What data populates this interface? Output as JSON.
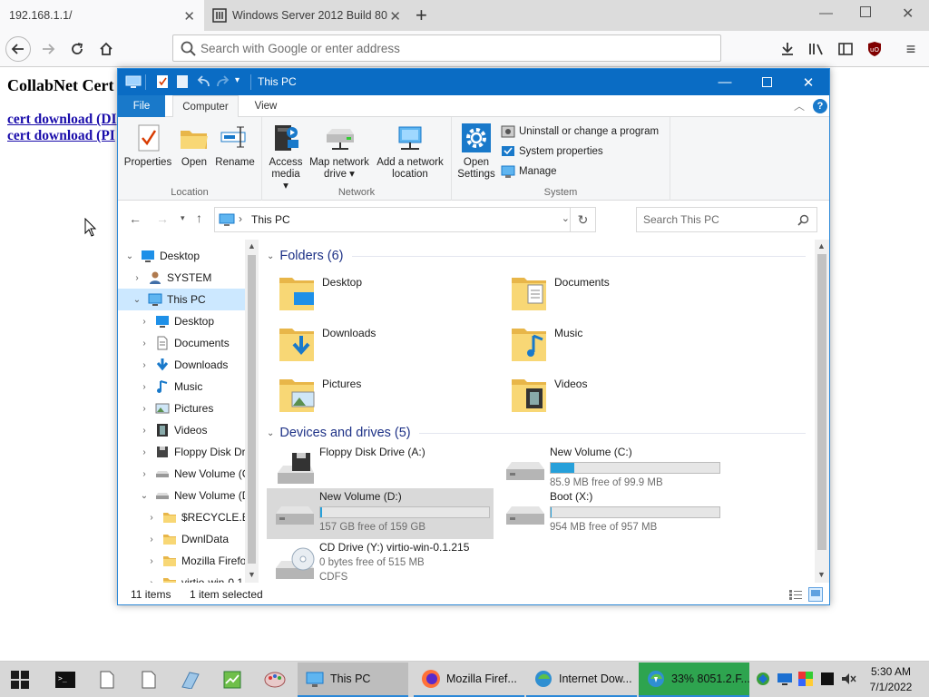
{
  "browser": {
    "tabs": [
      {
        "title": "192.168.1.1/",
        "active": true
      },
      {
        "title": "Windows Server 2012 Build 80",
        "active": false
      }
    ],
    "url_placeholder": "Search with Google or enter address"
  },
  "page": {
    "heading": "CollabNet Cert",
    "links": [
      "cert download (DI",
      "cert download (PI"
    ]
  },
  "explorer": {
    "title": "This PC",
    "ribbon_tabs": [
      "File",
      "Computer",
      "View"
    ],
    "active_ribbon_tab": "Computer",
    "groups": {
      "location": {
        "name": "Location",
        "buttons": [
          "Properties",
          "Open",
          "Rename"
        ]
      },
      "network": {
        "name": "Network",
        "buttons": [
          {
            "line1": "Access",
            "line2": "media ▾"
          },
          {
            "line1": "Map network",
            "line2": "drive ▾"
          },
          {
            "line1": "Add a network",
            "line2": "location"
          }
        ]
      },
      "system": {
        "name": "System",
        "open_settings": {
          "line1": "Open",
          "line2": "Settings"
        },
        "small": [
          "Uninstall or change a program",
          "System properties",
          "Manage"
        ]
      }
    },
    "address": "This PC",
    "search_placeholder": "Search This PC",
    "nav_tree": [
      {
        "label": "Desktop",
        "level": 0,
        "expanded": true,
        "icon": "desktop-icon"
      },
      {
        "label": "SYSTEM",
        "level": 1,
        "expanded": false,
        "icon": "user-icon"
      },
      {
        "label": "This PC",
        "level": 1,
        "expanded": true,
        "selected": true,
        "icon": "pc-icon"
      },
      {
        "label": "Desktop",
        "level": 2,
        "expanded": false,
        "icon": "desktop-icon"
      },
      {
        "label": "Documents",
        "level": 2,
        "expanded": false,
        "icon": "documents-icon"
      },
      {
        "label": "Downloads",
        "level": 2,
        "expanded": false,
        "icon": "downloads-icon"
      },
      {
        "label": "Music",
        "level": 2,
        "expanded": false,
        "icon": "music-icon"
      },
      {
        "label": "Pictures",
        "level": 2,
        "expanded": false,
        "icon": "pictures-icon"
      },
      {
        "label": "Videos",
        "level": 2,
        "expanded": false,
        "icon": "videos-icon"
      },
      {
        "label": "Floppy Disk Dri",
        "level": 2,
        "expanded": false,
        "icon": "floppy-icon"
      },
      {
        "label": "New Volume (C",
        "level": 2,
        "expanded": false,
        "icon": "drive-icon"
      },
      {
        "label": "New Volume (D",
        "level": 2,
        "expanded": true,
        "icon": "drive-icon"
      },
      {
        "label": "$RECYCLE.BIN",
        "level": 3,
        "expanded": false,
        "icon": "folder-icon"
      },
      {
        "label": "DwnlData",
        "level": 3,
        "expanded": false,
        "icon": "folder-icon"
      },
      {
        "label": "Mozilla Firefo",
        "level": 3,
        "expanded": false,
        "icon": "folder-icon"
      },
      {
        "label": "virtio-win-0.1",
        "level": 3,
        "expanded": false,
        "icon": "folder-icon"
      }
    ],
    "folders_header": "Folders (6)",
    "folders": [
      {
        "name": "Desktop",
        "icon": "desktop-folder-icon"
      },
      {
        "name": "Documents",
        "icon": "documents-folder-icon"
      },
      {
        "name": "Downloads",
        "icon": "downloads-folder-icon"
      },
      {
        "name": "Music",
        "icon": "music-folder-icon"
      },
      {
        "name": "Pictures",
        "icon": "pictures-folder-icon"
      },
      {
        "name": "Videos",
        "icon": "videos-folder-icon"
      }
    ],
    "drives_header": "Devices and drives (5)",
    "drives": [
      {
        "name": "Floppy Disk Drive (A:)",
        "free": "",
        "used_fraction": null,
        "icon": "floppy-drive-icon"
      },
      {
        "name": "New Volume (C:)",
        "free": "85.9 MB free of 99.9 MB",
        "used_fraction": 0.14,
        "icon": "hard-drive-icon"
      },
      {
        "name": "New Volume (D:)",
        "free": "157 GB free of 159 GB",
        "used_fraction": 0.01,
        "selected": true,
        "icon": "hard-drive-icon"
      },
      {
        "name": "Boot (X:)",
        "free": "954 MB free of 957 MB",
        "used_fraction": 0.0,
        "icon": "hard-drive-icon"
      },
      {
        "name": "CD Drive (Y:) virtio-win-0.1.215",
        "free": "0 bytes free of 515 MB",
        "extra": "CDFS",
        "used_fraction": null,
        "icon": "cd-drive-icon"
      }
    ],
    "status": {
      "items": "11 items",
      "selected": "1 item selected"
    }
  },
  "taskbar": {
    "apps": [
      {
        "label": "This PC",
        "active": true,
        "icon": "explorer-icon"
      },
      {
        "label": "Mozilla Firef...",
        "active": false,
        "icon": "firefox-icon"
      },
      {
        "label": "Internet Dow...",
        "active": false,
        "icon": "idm-icon"
      },
      {
        "label": "33% 8051.2.F...",
        "active": false,
        "icon": "idm-progress-icon"
      }
    ],
    "time": "5:30 AM",
    "date": "7/1/2022"
  },
  "colors": {
    "accent": "#0a6cc4",
    "selection": "#cce8ff",
    "drive_bar": "#26a0da",
    "group_header": "#1e3287"
  }
}
